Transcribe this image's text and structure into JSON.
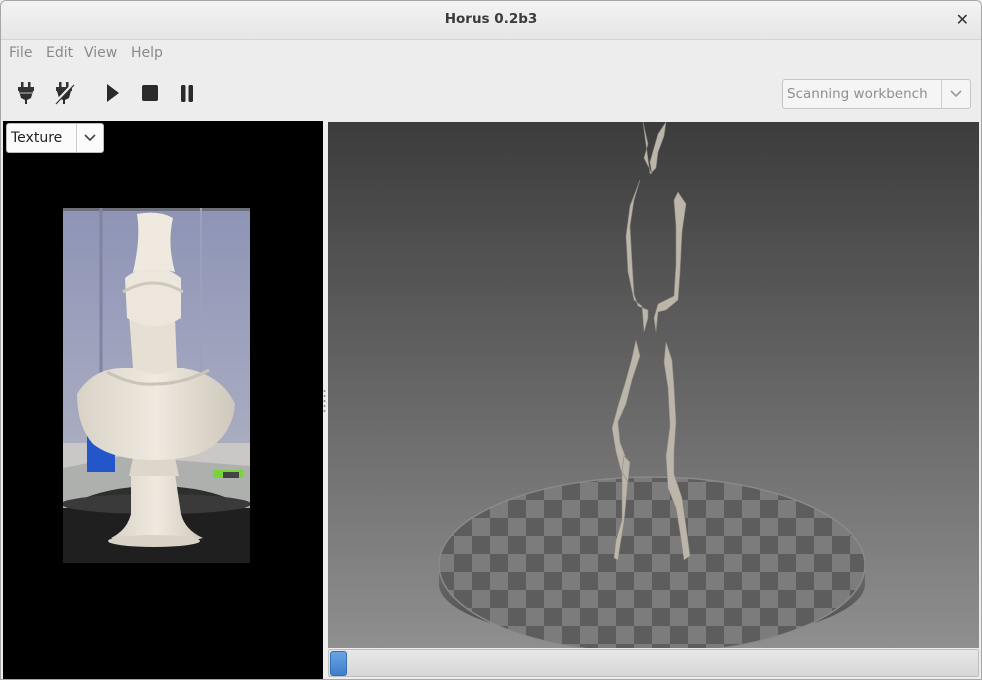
{
  "window": {
    "title": "Horus 0.2b3",
    "close_icon": "close-icon"
  },
  "menu": [
    {
      "label": "File"
    },
    {
      "label": "Edit"
    },
    {
      "label": "View"
    },
    {
      "label": "Help"
    }
  ],
  "toolbar": {
    "buttons": [
      {
        "icon": "connect-icon"
      },
      {
        "icon": "disconnect-icon"
      },
      {
        "icon": "play-icon"
      },
      {
        "icon": "stop-icon"
      },
      {
        "icon": "pause-icon"
      }
    ],
    "workbench_select": {
      "value": "Scanning workbench"
    }
  },
  "left_panel": {
    "view_select": {
      "value": "Texture"
    }
  },
  "scan": {
    "progress": 0.0
  },
  "colors": {
    "accent": "#3d7fcc",
    "viewport_top": "#3c3c3c",
    "viewport_bottom": "#8f8f8f",
    "platform_dark": "#5c5c5c",
    "platform_light": "#7a7a7a",
    "pointcloud": "#b9b2a6"
  }
}
